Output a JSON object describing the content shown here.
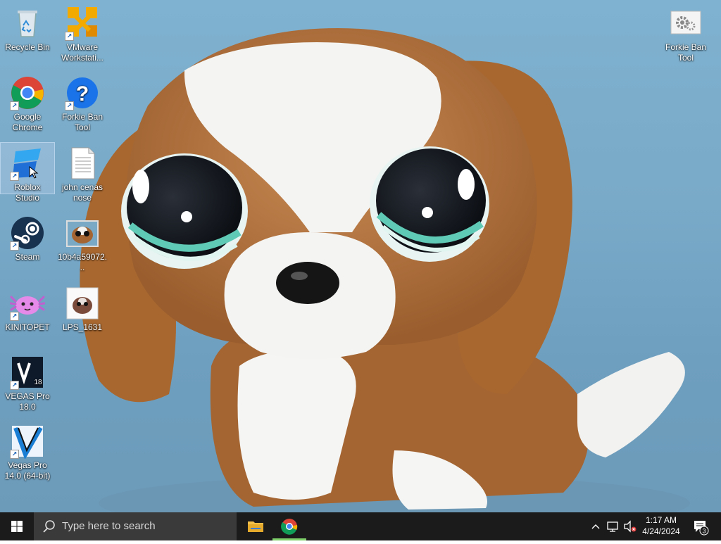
{
  "desktop": {
    "icons": [
      {
        "label": "Recycle Bin",
        "icon": "recycle-bin-icon"
      },
      {
        "label": "VMware Workstati...",
        "icon": "vmware-icon"
      },
      {
        "label": "Google Chrome",
        "icon": "chrome-icon"
      },
      {
        "label": "Forkie Ban Tool",
        "icon": "help-question-icon"
      },
      {
        "label": "Roblox Studio",
        "icon": "roblox-studio-icon"
      },
      {
        "label": "john cenas nose",
        "icon": "text-document-icon"
      },
      {
        "label": "Steam",
        "icon": "steam-icon"
      },
      {
        "label": "10b4a59072...",
        "icon": "image-file-icon"
      },
      {
        "label": "KINITOPET",
        "icon": "kinitopet-icon"
      },
      {
        "label": "LPS_1631",
        "icon": "image-file-icon"
      },
      {
        "label": "VEGAS Pro 18.0",
        "icon": "vegas-pro-18-icon"
      },
      {
        "label": "Vegas Pro 14.0 (64-bit)",
        "icon": "vegas-pro-14-icon"
      },
      {
        "label": "Forkie Ban Tool",
        "icon": "settings-gears-icon"
      }
    ],
    "vegas_version_badge": "18"
  },
  "taskbar": {
    "search_placeholder": "Type here to search",
    "time": "1:17 AM",
    "date": "4/24/2024",
    "notification_count": "3"
  },
  "colors": {
    "taskbar_bg": "#1b1b1b",
    "search_bg": "#3a3a3a",
    "active_indicator": "#7fcf6a",
    "wallpaper_blue": "#79aac8"
  }
}
